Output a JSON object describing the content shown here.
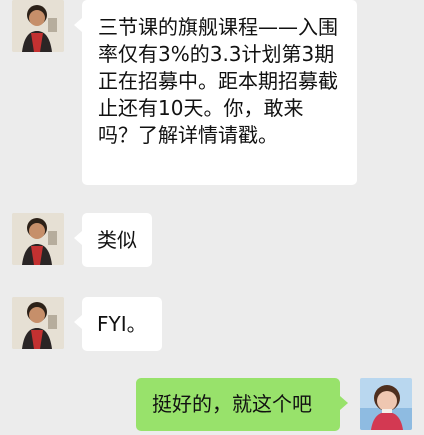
{
  "messages": [
    {
      "side": "left",
      "text": "三节课的旗舰课程——入围率仅有3%的3.3计划第3期正在招募中。距本期招募截止还有10天。你，敢来吗？了解详情请戳。"
    },
    {
      "side": "left",
      "text": "类似"
    },
    {
      "side": "left",
      "text": "FYI。"
    },
    {
      "side": "right",
      "text": "挺好的，就这个吧"
    }
  ],
  "colors": {
    "background": "#ececec",
    "left_bubble": "#ffffff",
    "right_bubble": "#98e26b"
  },
  "icons": {
    "left_avatar": "person-photo-avatar",
    "right_avatar": "person-photo-avatar"
  }
}
